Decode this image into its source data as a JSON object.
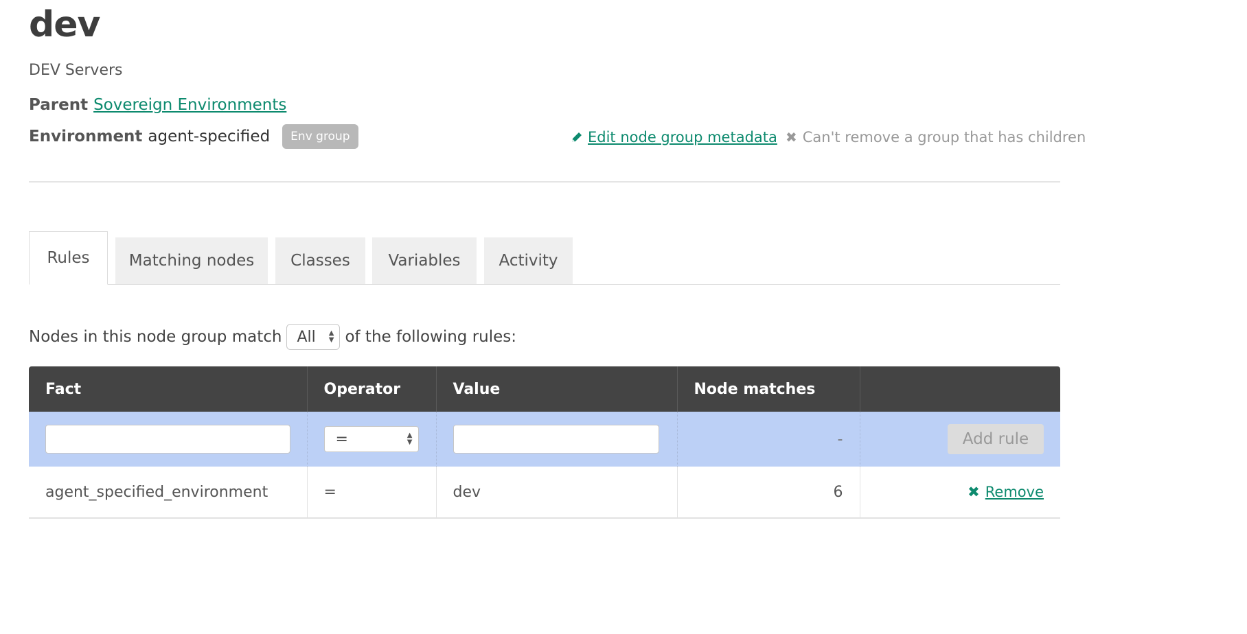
{
  "group": {
    "name": "dev",
    "description": "DEV Servers",
    "parent_label": "Parent",
    "parent_name": "Sovereign Environments",
    "environment_label": "Environment",
    "environment_value": "agent-specified",
    "env_badge": "Env group"
  },
  "actions": {
    "edit_label": "Edit node group metadata",
    "cant_remove_label": "Can't remove a group that has children",
    "pencil_icon": "pencil-icon",
    "x_icon": "x-icon"
  },
  "tabs": [
    {
      "label": "Rules",
      "active": true
    },
    {
      "label": "Matching nodes",
      "active": false
    },
    {
      "label": "Classes",
      "active": false
    },
    {
      "label": "Variables",
      "active": false
    },
    {
      "label": "Activity",
      "active": false
    }
  ],
  "rules": {
    "match_prefix": "Nodes in this node group match",
    "match_value": "All",
    "match_suffix": "of the following rules:",
    "columns": [
      "Fact",
      "Operator",
      "Value",
      "Node matches",
      ""
    ],
    "new_rule": {
      "fact_value": "",
      "operator_value": "=",
      "value_value": "",
      "node_matches": "-",
      "add_label": "Add rule"
    },
    "rows": [
      {
        "fact": "agent_specified_environment",
        "operator": "=",
        "value": "dev",
        "node_matches": "6",
        "remove_label": "Remove"
      }
    ]
  },
  "colors": {
    "link": "#0d8a6e",
    "table_header": "#444444",
    "input_row": "#bcd0f6",
    "badge": "#b8b8b8"
  }
}
